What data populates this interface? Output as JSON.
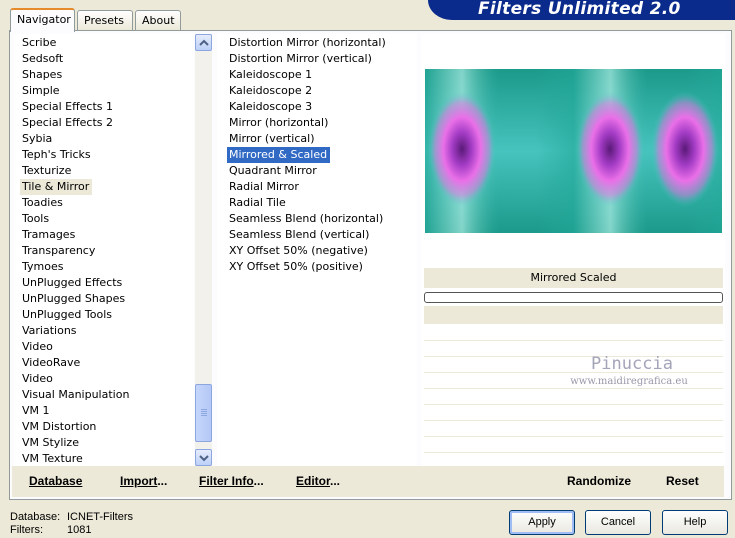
{
  "tabs": [
    "Navigator",
    "Presets",
    "About"
  ],
  "banner": "Filters Unlimited 2.0",
  "categories": [
    "Scribe",
    "Sedsoft",
    "Shapes",
    "Simple",
    "Special Effects 1",
    "Special Effects 2",
    "Sybia",
    "Teph's Tricks",
    "Texturize",
    "Tile & Mirror",
    "Toadies",
    "Tools",
    "Tramages",
    "Transparency",
    "Tymoes",
    "UnPlugged Effects",
    "UnPlugged Shapes",
    "UnPlugged Tools",
    "Variations",
    "Video",
    "VideoRave",
    "Video",
    "Visual Manipulation",
    "VM 1",
    "VM Distortion",
    "VM Stylize",
    "VM Texture"
  ],
  "selected_category": "Tile & Mirror",
  "filters": [
    "Distortion Mirror (horizontal)",
    "Distortion Mirror (vertical)",
    "Kaleidoscope 1",
    "Kaleidoscope 2",
    "Kaleidoscope 3",
    "Mirror (horizontal)",
    "Mirror (vertical)",
    "Mirrored & Scaled",
    "Quadrant Mirror",
    "Radial Mirror",
    "Radial Tile",
    "Seamless Blend (horizontal)",
    "Seamless Blend (vertical)",
    "XY Offset 50% (negative)",
    "XY Offset 50% (positive)"
  ],
  "selected_filter": "Mirrored & Scaled",
  "preview": {
    "filter_label": "Mirrored  Scaled",
    "watermark": "Pinuccia",
    "watermark_url": "www.maidiregrafica.eu"
  },
  "bottom_buttons": {
    "database": "Database",
    "import": "Import...",
    "filter_info": "Filter Info...",
    "editor": "Editor...",
    "randomize": "Randomize",
    "reset": "Reset"
  },
  "status": {
    "database_label": "Database:",
    "database_value": "ICNET-Filters",
    "filters_label": "Filters:",
    "filters_value": "1081"
  },
  "dialog_buttons": {
    "apply": "Apply",
    "cancel": "Cancel",
    "help": "Help"
  },
  "colors": {
    "selection": "#316ac5",
    "banner": "#0a2a8c",
    "tab_accent": "#e68b2c"
  }
}
